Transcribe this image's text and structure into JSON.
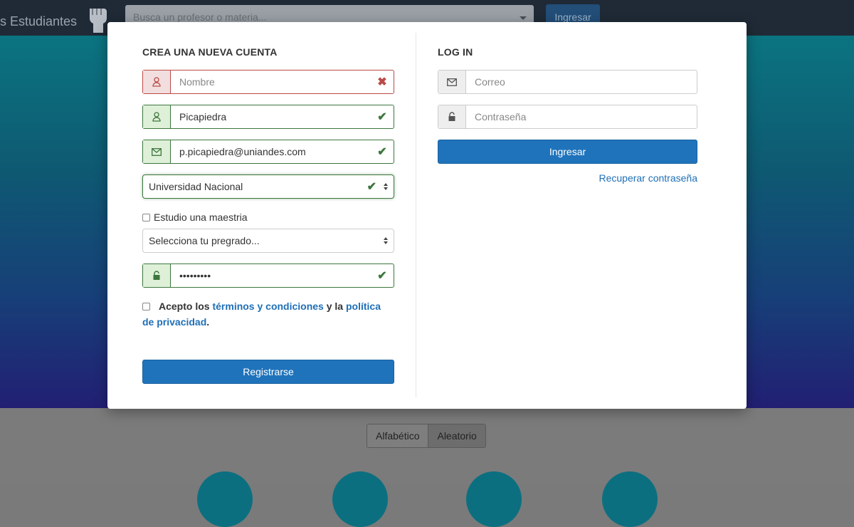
{
  "navbar": {
    "brand": "s Estudiantes",
    "search_placeholder": "Busca un profesor o materia...",
    "login_button": "Ingresar"
  },
  "sort": {
    "options": [
      "Alfabético",
      "Aleatorio"
    ],
    "active": "Aleatorio"
  },
  "register": {
    "title": "CREA UNA NUEVA CUENTA",
    "first_name_placeholder": "Nombre",
    "last_name_value": "Picapiedra",
    "email_value": "p.picapiedra@uniandes.com",
    "university_value": "Universidad Nacional",
    "masters_label": "Estudio una maestria",
    "undergrad_value": "Selecciona tu pregrado...",
    "password_value": "•••••••••",
    "terms_prefix": "Acepto los",
    "terms_link": "términos y condiciones",
    "terms_middle": "y la",
    "privacy_link": "política de privacidad",
    "terms_suffix": ".",
    "submit_label": "Registrarse"
  },
  "login": {
    "title": "LOG IN",
    "email_placeholder": "Correo",
    "password_placeholder": "Contraseña",
    "submit_label": "Ingresar",
    "recover_link": "Recuperar contraseña"
  },
  "colors": {
    "primary": "#1f73bb",
    "success": "#3c763d",
    "error": "#b94a48",
    "link": "#1f6fb7"
  }
}
